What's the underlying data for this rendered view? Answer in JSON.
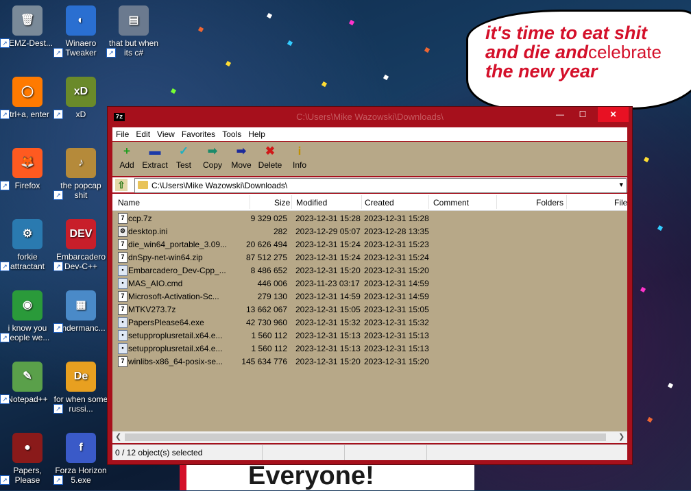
{
  "desktop": {
    "icons": [
      {
        "label": "MEMZ-Dest...",
        "glyph": "🗑"
      },
      {
        "label": "Winaero Tweaker",
        "glyph": "◐"
      },
      {
        "label": "that but when its c#",
        "glyph": "▤"
      },
      {
        "label": "ctrl+a, enter",
        "glyph": "◯"
      },
      {
        "label": "xD",
        "glyph": "xD"
      },
      {
        "label": "Firefox",
        "glyph": "🦊"
      },
      {
        "label": "the popcap shit",
        "glyph": "♪"
      },
      {
        "label": "forkie attractant",
        "glyph": "⚙"
      },
      {
        "label": "Embarcadero Dev-C++",
        "glyph": "DEV"
      },
      {
        "label": "i know you people we...",
        "glyph": "◉"
      },
      {
        "label": "Endermanc...",
        "glyph": "▦"
      },
      {
        "label": "Notepad++",
        "glyph": "✎"
      },
      {
        "label": "for when some russi...",
        "glyph": "De"
      },
      {
        "label": "Papers, Please",
        "glyph": "●"
      },
      {
        "label": "Forza Horizon 5.exe",
        "glyph": "f"
      }
    ],
    "meme_text": {
      "line1": "it's time to eat shit",
      "line2": "and die and",
      "line2b": "celebrate",
      "line3": "the new year"
    },
    "bottom_banner": "Everyone!"
  },
  "window": {
    "title": "C:\\Users\\Mike Wazowski\\Downloads\\",
    "app_icon": "7z",
    "controls": {
      "minimize": "—",
      "maximize": "☐",
      "close": "✕"
    },
    "menu": [
      "File",
      "Edit",
      "View",
      "Favorites",
      "Tools",
      "Help"
    ],
    "toolbar": [
      {
        "label": "Add",
        "glyph": "+",
        "color": "#1e9e1e"
      },
      {
        "label": "Extract",
        "glyph": "▬",
        "color": "#1c3aa8"
      },
      {
        "label": "Test",
        "glyph": "✓",
        "color": "#20b0c0"
      },
      {
        "label": "Copy",
        "glyph": "➡",
        "color": "#1b8a6a"
      },
      {
        "label": "Move",
        "glyph": "➡",
        "color": "#1c2a9a"
      },
      {
        "label": "Delete",
        "glyph": "✖",
        "color": "#d01818"
      },
      {
        "label": "Info",
        "glyph": "i",
        "color": "#c09000"
      }
    ],
    "address": "C:\\Users\\Mike Wazowski\\Downloads\\",
    "columns": [
      "Name",
      "Size",
      "Modified",
      "Created",
      "Comment",
      "Folders",
      "File"
    ],
    "files": [
      {
        "name": "ccp.7z",
        "size": "9 329 025",
        "modified": "2023-12-31 15:28",
        "created": "2023-12-31 15:28",
        "type": "7z"
      },
      {
        "name": "desktop.ini",
        "size": "282",
        "modified": "2023-12-29 05:07",
        "created": "2023-12-28 13:35",
        "type": "ini"
      },
      {
        "name": "die_win64_portable_3.09...",
        "size": "20 626 494",
        "modified": "2023-12-31 15:24",
        "created": "2023-12-31 15:23",
        "type": "7z"
      },
      {
        "name": "dnSpy-net-win64.zip",
        "size": "87 512 275",
        "modified": "2023-12-31 15:24",
        "created": "2023-12-31 15:24",
        "type": "7z"
      },
      {
        "name": "Embarcadero_Dev-Cpp_...",
        "size": "8 486 652",
        "modified": "2023-12-31 15:20",
        "created": "2023-12-31 15:20",
        "type": "exe"
      },
      {
        "name": "MAS_AIO.cmd",
        "size": "446 006",
        "modified": "2023-11-23 03:17",
        "created": "2023-12-31 14:59",
        "type": "cmd"
      },
      {
        "name": "Microsoft-Activation-Sc...",
        "size": "279 130",
        "modified": "2023-12-31 14:59",
        "created": "2023-12-31 14:59",
        "type": "7z"
      },
      {
        "name": "MTKV273.7z",
        "size": "13 662 067",
        "modified": "2023-12-31 15:05",
        "created": "2023-12-31 15:05",
        "type": "7z"
      },
      {
        "name": "PapersPlease64.exe",
        "size": "42 730 960",
        "modified": "2023-12-31 15:32",
        "created": "2023-12-31 15:32",
        "type": "exe"
      },
      {
        "name": "setupproplusretail.x64.e...",
        "size": "1 560 112",
        "modified": "2023-12-31 15:13",
        "created": "2023-12-31 15:13",
        "type": "exe"
      },
      {
        "name": "setupproplusretail.x64.e...",
        "size": "1 560 112",
        "modified": "2023-12-31 15:13",
        "created": "2023-12-31 15:13",
        "type": "exe"
      },
      {
        "name": "winlibs-x86_64-posix-se...",
        "size": "145 634 776",
        "modified": "2023-12-31 15:20",
        "created": "2023-12-31 15:20",
        "type": "7z"
      }
    ],
    "status": "0 / 12 object(s) selected"
  }
}
